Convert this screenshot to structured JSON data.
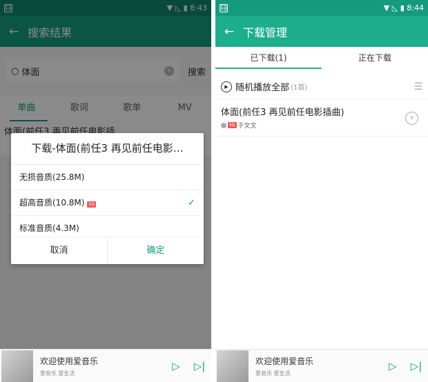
{
  "left": {
    "status": {
      "app": "爱音\n天宫",
      "time": "8:43"
    },
    "appbar": {
      "title": "搜索结果"
    },
    "search": {
      "value": "体面",
      "button": "搜索"
    },
    "tabs": [
      "单曲",
      "歌词",
      "歌单",
      "MV"
    ],
    "result": {
      "title": "体面(前任3 再见前任电影插"
    },
    "dialog": {
      "title": "下载-体面(前任3 再见前任电影…",
      "options": [
        {
          "label": "无损音质(25.8M)",
          "badge": "",
          "checked": false
        },
        {
          "label": "超高音质(10.8M)",
          "badge": "SQ",
          "checked": true
        },
        {
          "label": "标准音质(4.3M)",
          "badge": "",
          "checked": false
        }
      ],
      "cancel": "取消",
      "confirm": "确定"
    },
    "player": {
      "title": "欢迎使用爱音乐",
      "subtitle": "爱音乐 爱生活"
    }
  },
  "right": {
    "status": {
      "app": "爱音\n天宫",
      "time": "8:44"
    },
    "appbar": {
      "title": "下载管理"
    },
    "tabs": [
      "已下载(1)",
      "正在下载"
    ],
    "shuffle": {
      "label": "随机播放全部",
      "count": "(1首)"
    },
    "song": {
      "title": "体面(前任3 再见前任电影插曲)",
      "badge": "SQ",
      "artist": "于文文"
    },
    "player": {
      "title": "欢迎使用爱音乐",
      "subtitle": "爱音乐 爱生活"
    }
  },
  "colors": {
    "accent": "#1dae8c",
    "accent_dark": "#159a7d",
    "badge": "#e85a5a"
  },
  "icons": {
    "back": "back-arrow-icon",
    "wifi": "wifi-icon",
    "battery": "battery-icon",
    "play": "play-icon",
    "next": "next-icon",
    "more": "more-icon",
    "list": "list-icon"
  }
}
